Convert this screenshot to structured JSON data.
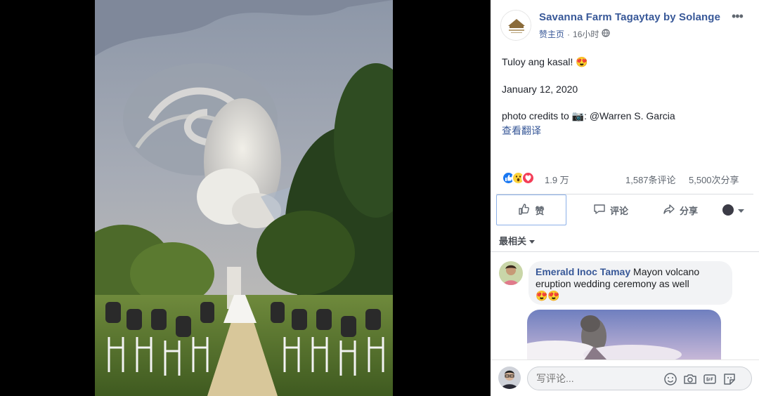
{
  "post": {
    "page_name": "Savanna Farm Tagaytay by Solange",
    "sponsor_label": "赞主页",
    "time": "16小时",
    "caption_line1": "Tuloy ang kasal! 😍",
    "date_line": "January 12, 2020",
    "credits_line": "photo credits to 📷: @Warren S. Garcia",
    "translate_label": "查看翻译"
  },
  "reactions": {
    "count": "1.9 万",
    "comments": "1,587条评论",
    "shares": "5,500次分享",
    "icons": [
      "like-icon",
      "wow-icon",
      "love-icon"
    ]
  },
  "actions": {
    "like": "赞",
    "comment": "评论",
    "share": "分享"
  },
  "sort_label": "最相关",
  "comment": {
    "author": "Emerald Inoc Tamay",
    "text": "Mayon volcano eruption wedding ceremony as well",
    "emoji": "😍😍"
  },
  "composer": {
    "placeholder": "写评论..."
  },
  "colors": {
    "link": "#385898",
    "like_blue": "#1877f2",
    "love_red": "#f33e58",
    "wow_yellow": "#fcd23a"
  }
}
